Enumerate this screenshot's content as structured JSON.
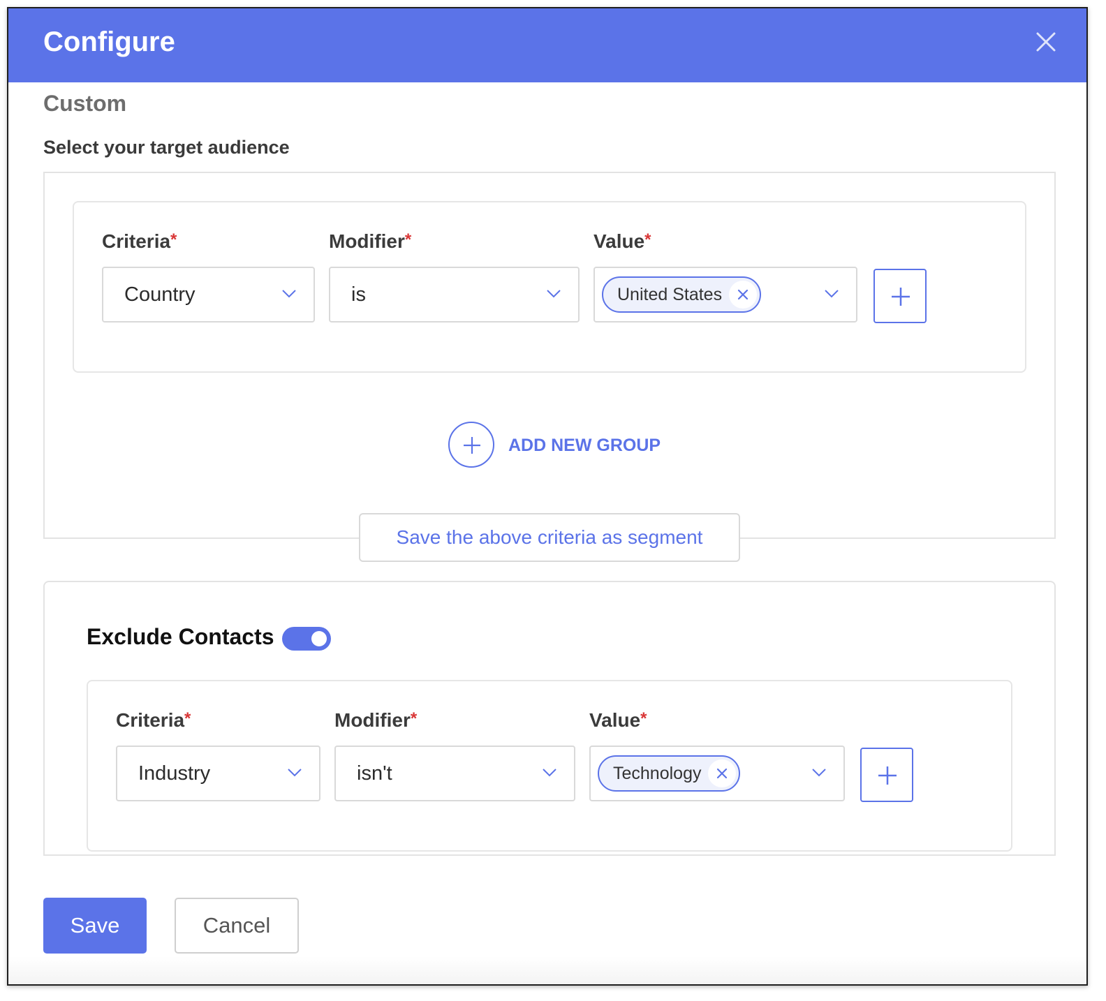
{
  "dialog": {
    "title": "Configure",
    "subtitle": "Custom",
    "section_label": "Select your target audience"
  },
  "include_group": {
    "criteria_label": "Criteria",
    "modifier_label": "Modifier",
    "value_label": "Value",
    "required_mark": "*",
    "criteria_value": "Country",
    "modifier_value": "is",
    "value_chip": "United States"
  },
  "add_new_group_label": "ADD NEW GROUP",
  "save_segment_label": "Save the above criteria as segment",
  "exclude": {
    "title": "Exclude Contacts",
    "toggle_on": true,
    "criteria_label": "Criteria",
    "modifier_label": "Modifier",
    "value_label": "Value",
    "required_mark": "*",
    "criteria_value": "Industry",
    "modifier_value": "isn't",
    "value_chip": "Technology"
  },
  "actions": {
    "save_label": "Save",
    "cancel_label": "Cancel"
  },
  "colors": {
    "accent": "#5b73e8",
    "required": "#d93636"
  }
}
